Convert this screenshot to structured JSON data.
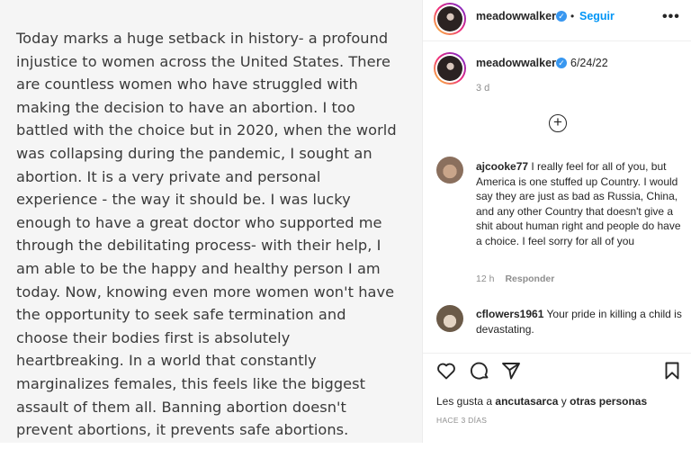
{
  "post_text_lines": [
    "Today marks a huge setback in history- a profound",
    "injustice to women across the United States. There",
    "are countless women who have struggled with",
    "making the decision to have an abortion. I too",
    "battled with the choice but in 2020, when the world",
    "was collapsing during the pandemic, I sought an",
    "abortion. It is a very private and personal",
    "experience - the way it should be. I was lucky",
    "enough to have a great doctor who supported me",
    "through the debilitating process- with their help, I",
    "am able to be the happy and healthy person I am",
    "today. Now, knowing even more women won't have",
    "the opportunity to seek safe termination and",
    "choose their bodies first is absolutely",
    "heartbreaking. In a world that constantly",
    "marginalizes females, this feels like the biggest",
    "assault of them all. Banning abortion doesn't",
    "prevent abortions, it prevents safe abortions."
  ],
  "header": {
    "username": "meadowwalker",
    "separator": "•",
    "follow_label": "Seguir",
    "more_label": "•••"
  },
  "caption": {
    "username": "meadowwalker",
    "date": "6/24/22",
    "age": "3 d"
  },
  "comments": [
    {
      "username": "ajcooke77",
      "text": "I really feel for all of you, but America is one stuffed up Country. I would say they are just as bad as Russia, China, and any other Country that doesn't give a shit about human right and people do have a choice. I feel sorry for all of you",
      "time": "12 h",
      "reply_label": "Responder"
    },
    {
      "username": "cflowers1961",
      "text": "Your pride in killing a child is devastating."
    }
  ],
  "likes": {
    "prefix": "Les gusta a",
    "user": "ancutasarca",
    "connector": "y",
    "others": "otras personas"
  },
  "time_ago": "HACE 3 DÍAS",
  "icons": {
    "verified": "verified-badge-icon",
    "add_comment": "add-circle-icon",
    "like": "heart-icon",
    "comment": "comment-icon",
    "share": "send-icon",
    "save": "bookmark-icon"
  },
  "colors": {
    "link_blue": "#0095f6",
    "verified_blue": "#3897f0",
    "text": "#262626",
    "muted": "#8e8e8e"
  }
}
